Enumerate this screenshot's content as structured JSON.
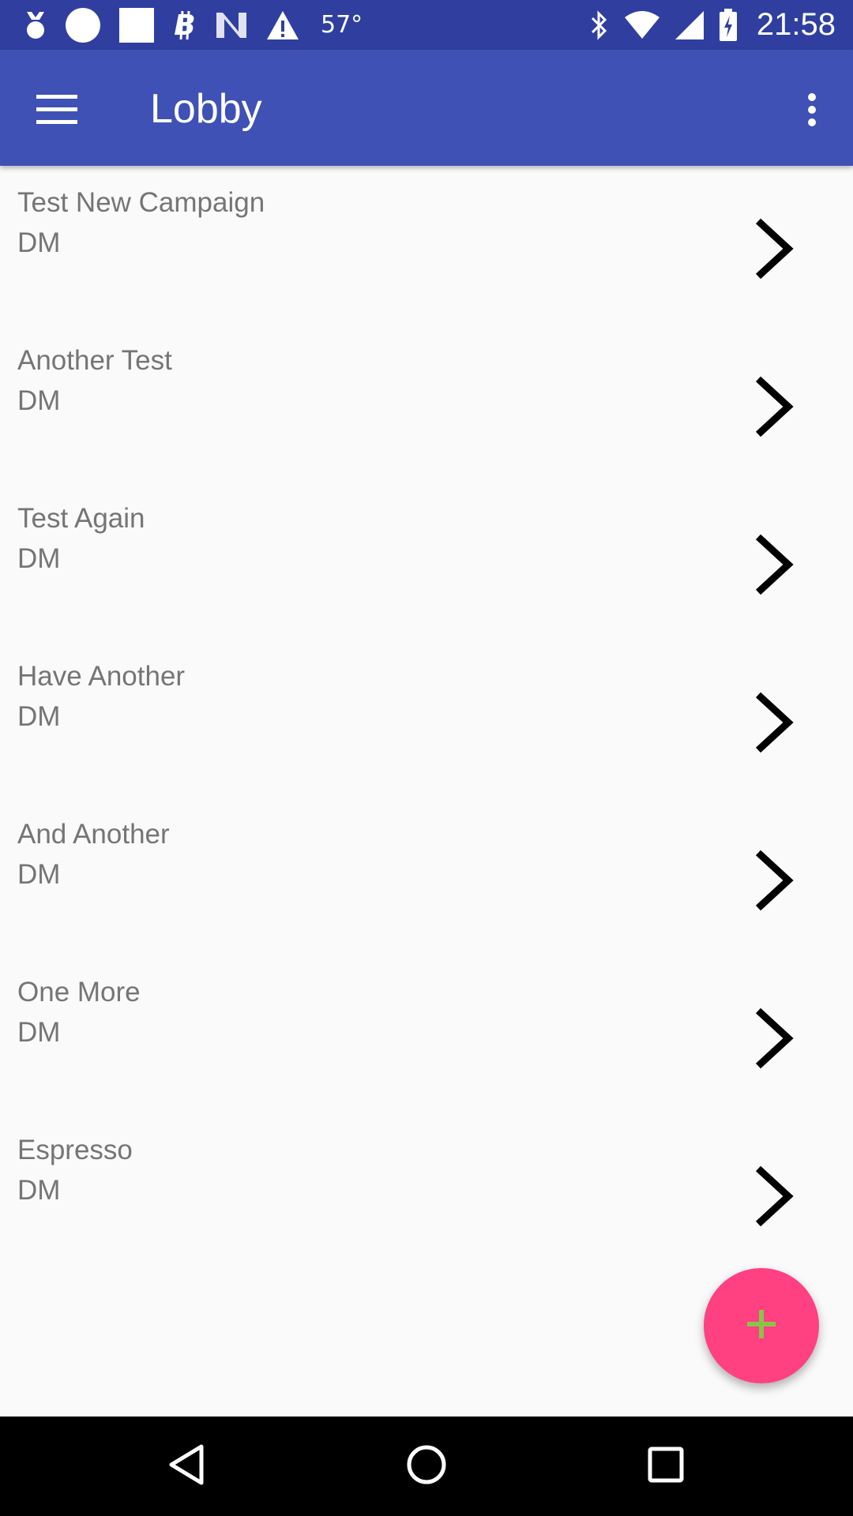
{
  "status_bar": {
    "temperature": "57°",
    "time": "21:58",
    "left_icons": [
      "medal-icon",
      "circle-notification-icon",
      "square-notification-icon",
      "bitcoin-icon",
      "n-app-icon",
      "warning-icon"
    ],
    "right_icons": [
      "bluetooth-icon",
      "wifi-icon",
      "signal-icon",
      "battery-charging-icon"
    ]
  },
  "app_bar": {
    "title": "Lobby",
    "menu_icon": "hamburger-menu-icon",
    "overflow_icon": "more-vert-icon"
  },
  "campaigns": [
    {
      "name": "Test New Campaign",
      "role": "DM"
    },
    {
      "name": "Another Test",
      "role": "DM"
    },
    {
      "name": "Test Again",
      "role": "DM"
    },
    {
      "name": "Have Another",
      "role": "DM"
    },
    {
      "name": "And Another",
      "role": "DM"
    },
    {
      "name": "One More",
      "role": "DM"
    },
    {
      "name": "Espresso",
      "role": "DM"
    }
  ],
  "fab": {
    "icon": "plus-icon"
  },
  "nav_bar": {
    "icons": [
      "back-icon",
      "home-icon",
      "recents-icon"
    ]
  },
  "colors": {
    "status_bar": "#303f9f",
    "app_bar": "#3f51b5",
    "background": "#fafafa",
    "fab": "#ff4081",
    "fab_icon": "#8bc34a",
    "text": "#757575"
  }
}
